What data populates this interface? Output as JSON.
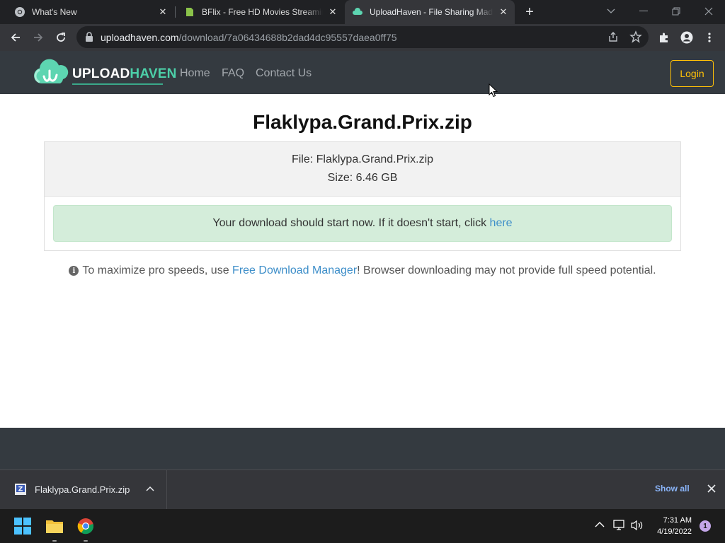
{
  "browser": {
    "tabs": [
      {
        "title": "What's New",
        "active": false
      },
      {
        "title": "BFlix - Free HD Movies Streaming",
        "active": false
      },
      {
        "title": "UploadHaven - File Sharing Made Simple",
        "active": true
      }
    ],
    "address": {
      "host": "uploadhaven.com",
      "path": "/download/7a06434688b2dad4dc95557daea0ff75"
    }
  },
  "site": {
    "logo": {
      "part1": "UPLOAD",
      "part2": "HAVEN"
    },
    "nav": [
      "Home",
      "FAQ",
      "Contact Us"
    ],
    "login_label": "Login"
  },
  "download": {
    "title": "Flaklypa.Grand.Prix.zip",
    "file_line": "File: Flaklypa.Grand.Prix.zip",
    "size_line": "Size: 6.46 GB",
    "alert_text": "Your download should start now. If it doesn't start, click",
    "alert_link": "here",
    "note_prefix": "To maximize pro speeds, use",
    "note_link": "Free Download Manager",
    "note_suffix": "! Browser downloading may not provide full speed potential."
  },
  "shelf": {
    "filename": "Flaklypa.Grand.Prix.zip",
    "show_all": "Show all"
  },
  "taskbar": {
    "time": "7:31 AM",
    "date": "4/19/2022",
    "notifications": "1"
  },
  "colors": {
    "accent": "#4ccfa8",
    "login": "#ffc107",
    "link": "#3d8ec9",
    "alert_bg": "#d4edda"
  }
}
